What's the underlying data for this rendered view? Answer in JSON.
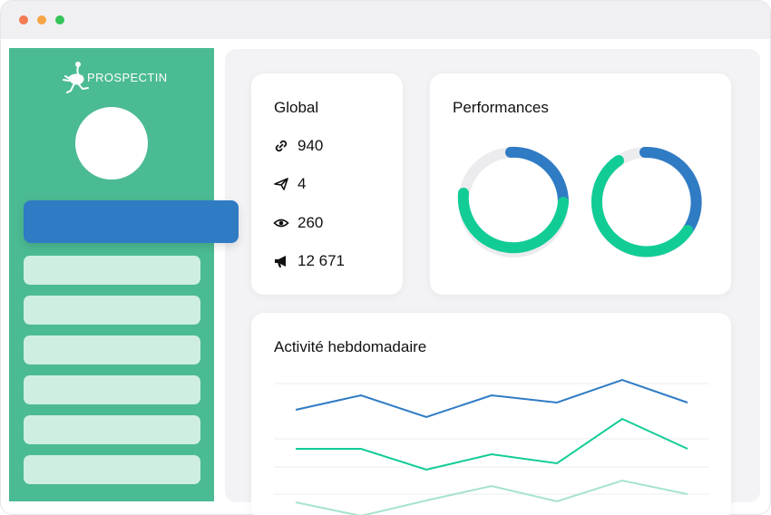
{
  "window": {
    "controls": [
      "close",
      "minimize",
      "maximize"
    ]
  },
  "brand": {
    "name": "PROSPECTIN",
    "logo_icon": "ostrich-icon"
  },
  "sidebar": {
    "active_item": 0,
    "item_count": 7
  },
  "global": {
    "title": "Global",
    "stats": [
      {
        "icon": "link-icon",
        "value": "940"
      },
      {
        "icon": "send-icon",
        "value": "4"
      },
      {
        "icon": "eye-icon",
        "value": "260"
      },
      {
        "icon": "megaphone-icon",
        "value": "12 671"
      }
    ]
  },
  "performances": {
    "title": "Performances",
    "colors": {
      "track": "#ececef",
      "primary": "#2f7bc4",
      "secondary": "#12cc96"
    }
  },
  "activity": {
    "title": "Activité hebdomadaire",
    "colors": [
      "#2f7bc4",
      "#12cc96",
      "#a7e3ce"
    ]
  },
  "colors": {
    "sidebar": "#4bbb93",
    "active": "#2f7bc4",
    "nav_item": "#cfeee2"
  }
}
